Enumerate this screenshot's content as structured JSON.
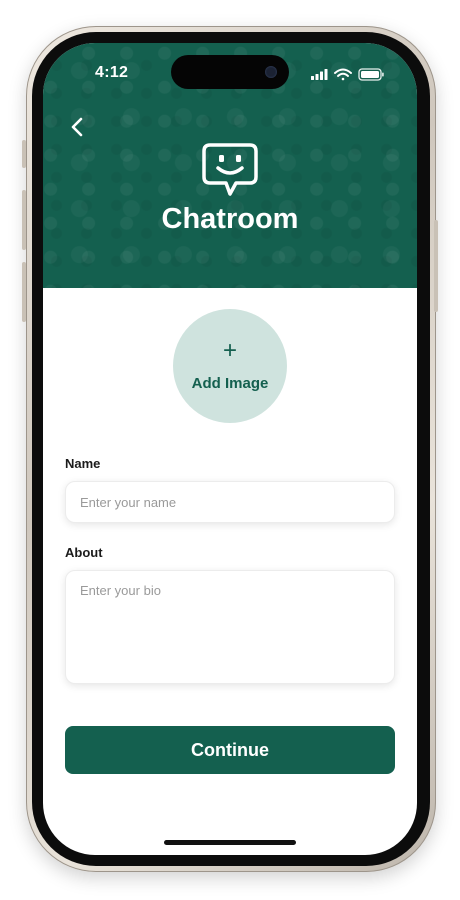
{
  "status_bar": {
    "time": "4:12",
    "icons": [
      "signal-icon",
      "wifi-icon",
      "battery-icon"
    ]
  },
  "header": {
    "back_icon": "chevron-left-icon",
    "logo_icon": "chat-smile-icon",
    "title": "Chatroom",
    "background_color": "#14604f"
  },
  "profile": {
    "add_image_icon": "plus-icon",
    "add_image_plus": "+",
    "add_image_label": "Add Image"
  },
  "form": {
    "name_label": "Name",
    "name_placeholder": "Enter your name",
    "name_value": "",
    "about_label": "About",
    "about_placeholder": "Enter your bio",
    "about_value": ""
  },
  "actions": {
    "continue_label": "Continue"
  },
  "colors": {
    "primary": "#14604f",
    "avatar_bg": "#cfe3de"
  }
}
